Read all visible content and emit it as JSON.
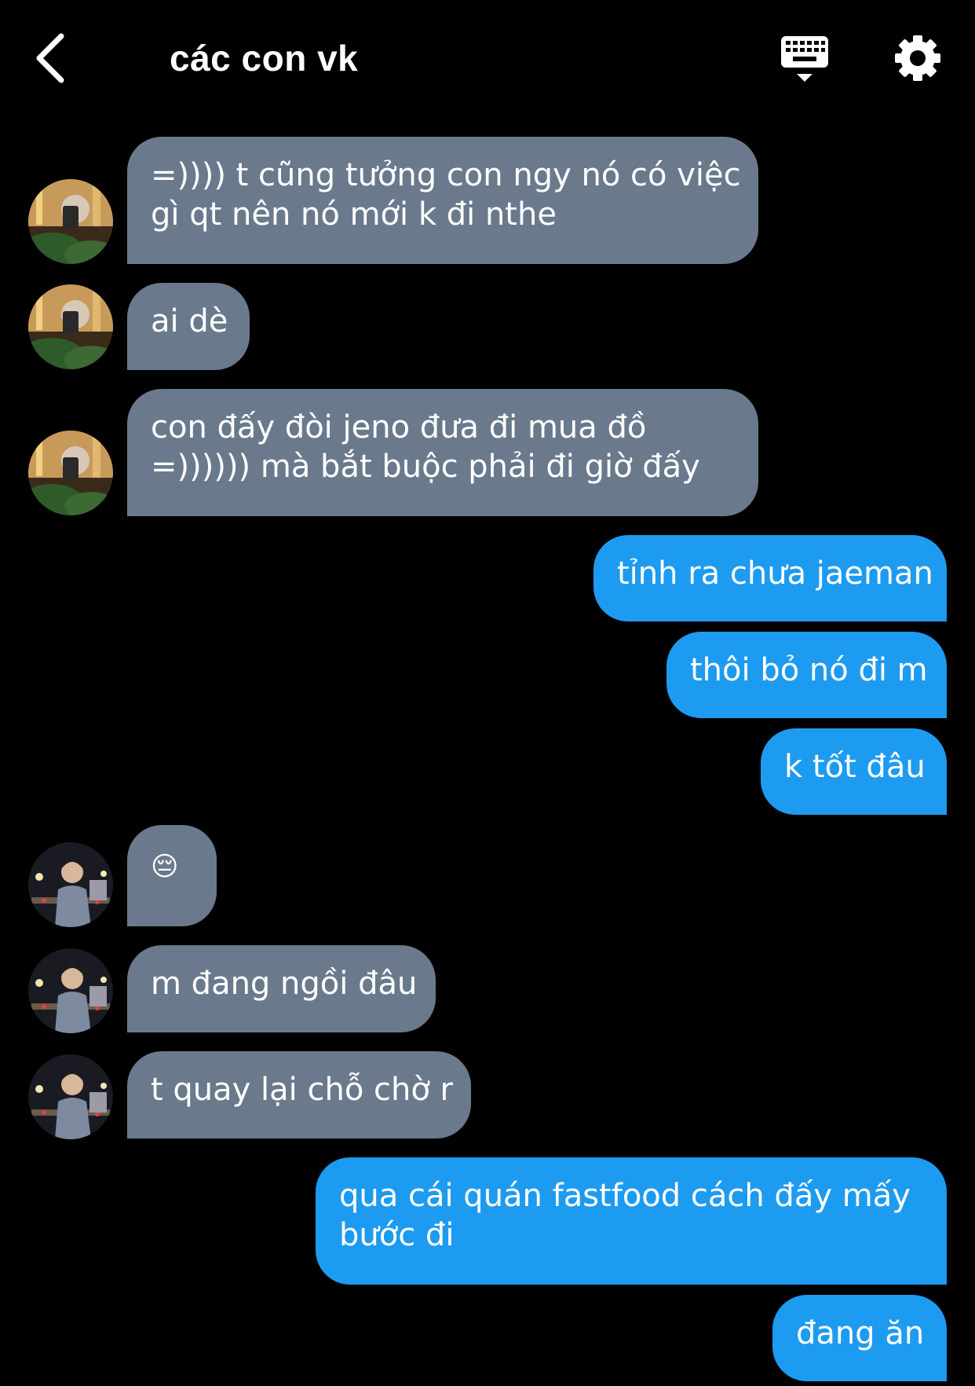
{
  "header": {
    "title": "các con vk",
    "back_icon": "chevron-left-icon",
    "keyboard_icon": "keyboard-icon",
    "settings_icon": "gear-icon"
  },
  "colors": {
    "background": "#000000",
    "incoming_bubble": "#6a7a8c",
    "outgoing_bubble": "#1d9bf0",
    "text": "#ffffff"
  },
  "messages": [
    {
      "side": "in",
      "sender": "a",
      "lines": [
        "=)))) t cũng tưởng con ngy nó có việc",
        "gì qt nên nó mới k đi nthe"
      ]
    },
    {
      "side": "in",
      "sender": "a",
      "lines": [
        "ai dè"
      ]
    },
    {
      "side": "in",
      "sender": "a",
      "lines": [
        "con đấy đòi jeno đưa đi mua đồ",
        "=)))))) mà bắt buộc phải đi giờ đấy"
      ]
    },
    {
      "side": "out",
      "lines": [
        "tỉnh ra chưa jaeman"
      ]
    },
    {
      "side": "out",
      "lines": [
        "thôi bỏ nó đi m"
      ]
    },
    {
      "side": "out",
      "lines": [
        "k tốt đâu"
      ]
    },
    {
      "side": "in",
      "sender": "b",
      "lines": [
        "😔"
      ]
    },
    {
      "side": "in",
      "sender": "b",
      "lines": [
        "m đang ngồi đâu"
      ]
    },
    {
      "side": "in",
      "sender": "b",
      "lines": [
        "t quay lại chỗ chờ r"
      ]
    },
    {
      "side": "out",
      "lines": [
        "qua cái quán fastfood cách đấy mấy",
        "bước đi"
      ]
    },
    {
      "side": "out",
      "lines": [
        "đang ăn"
      ]
    }
  ]
}
